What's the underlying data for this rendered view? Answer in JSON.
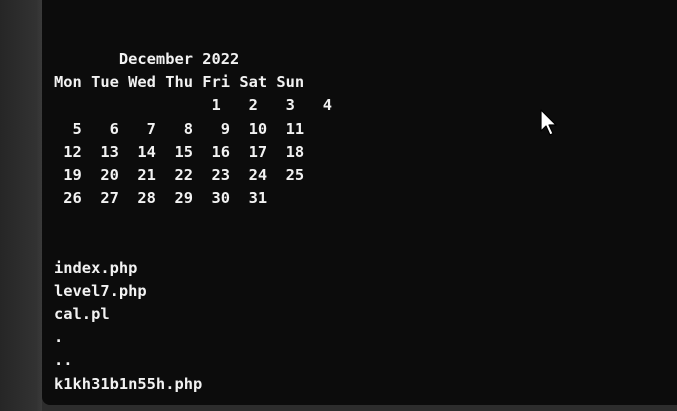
{
  "calendar": {
    "title": "       December 2022",
    "weekday_header": "Mon Tue Wed Thu Fri Sat Sun",
    "weeks": [
      "                 1   2   3   4",
      "  5   6   7   8   9  10  11",
      " 12  13  14  15  16  17  18",
      " 19  20  21  22  23  24  25",
      " 26  27  28  29  30  31"
    ]
  },
  "listing": {
    "files": [
      "index.php",
      "level7.php",
      "cal.pl",
      ".",
      "..",
      "k1kh31b1n55h.php"
    ]
  },
  "icons": {
    "pointer": "mouse-pointer-icon"
  }
}
